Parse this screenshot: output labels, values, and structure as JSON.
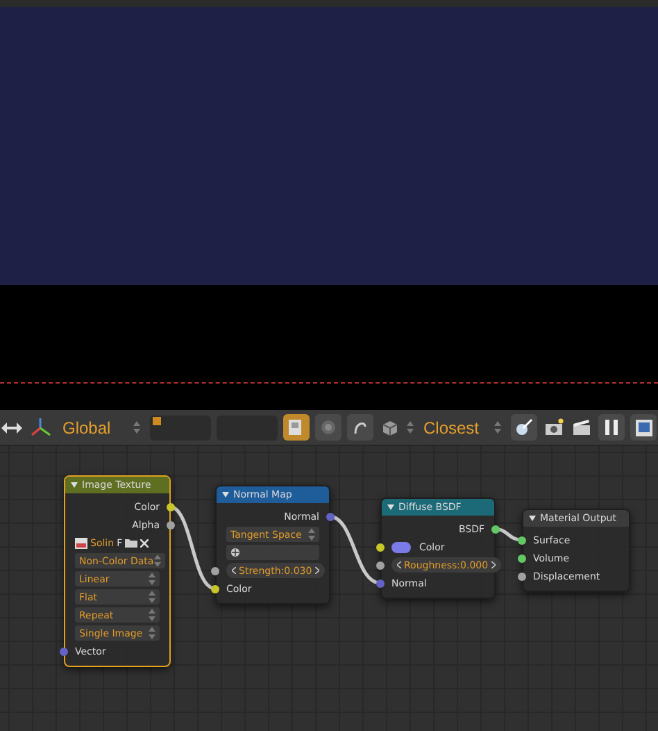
{
  "toolbar": {
    "orientation_menu": {
      "label": "Global"
    },
    "snap_toggle": {
      "on": true
    },
    "proportional_toggle": {
      "on": false
    },
    "snap_target_menu": {
      "label": "Closest"
    }
  },
  "nodes": [
    {
      "title": "Image Texture",
      "kind": "texture",
      "selected": true,
      "rows": [
        {
          "kind": "output",
          "label": "Color",
          "color": "#c7c729"
        },
        {
          "kind": "output",
          "label": "Alpha",
          "color": "#a1a1a1"
        },
        {
          "kind": "image",
          "value": "Solin",
          "frame": "F"
        },
        {
          "kind": "dropdown",
          "value": "Non-Color Data"
        },
        {
          "kind": "dropdown",
          "value": "Linear"
        },
        {
          "kind": "dropdown",
          "value": "Flat"
        },
        {
          "kind": "dropdown",
          "value": "Repeat"
        },
        {
          "kind": "dropdown",
          "value": "Single Image"
        },
        {
          "kind": "input",
          "label": "Vector",
          "color": "#6363c7"
        }
      ]
    },
    {
      "title": "Normal Map",
      "kind": "vector",
      "selected": false,
      "rows": [
        {
          "kind": "output",
          "label": "Normal",
          "color": "#6363c7"
        },
        {
          "kind": "dropdown",
          "value": "Tangent Space"
        },
        {
          "kind": "uv-field"
        },
        {
          "kind": "slider",
          "label": "Strength:",
          "value": "0.030",
          "color": "#a1a1a1"
        },
        {
          "kind": "input",
          "label": "Color",
          "color": "#c7c729"
        }
      ]
    },
    {
      "title": "Diffuse BSDF",
      "kind": "shader",
      "selected": false,
      "rows": [
        {
          "kind": "output",
          "label": "BSDF",
          "color": "#63c763"
        },
        {
          "kind": "color",
          "label": "Color",
          "color": "#7b7be8"
        },
        {
          "kind": "slider",
          "label": "Roughness:",
          "value": "0.000",
          "color": "#a1a1a1"
        },
        {
          "kind": "input",
          "label": "Normal",
          "color": "#6363c7"
        }
      ]
    },
    {
      "title": "Material Output",
      "kind": "output",
      "selected": false,
      "rows": [
        {
          "kind": "input",
          "label": "Surface",
          "color": "#63c763"
        },
        {
          "kind": "input",
          "label": "Volume",
          "color": "#63c763"
        },
        {
          "kind": "input",
          "label": "Displacement",
          "color": "#a1a1a1"
        }
      ]
    }
  ]
}
